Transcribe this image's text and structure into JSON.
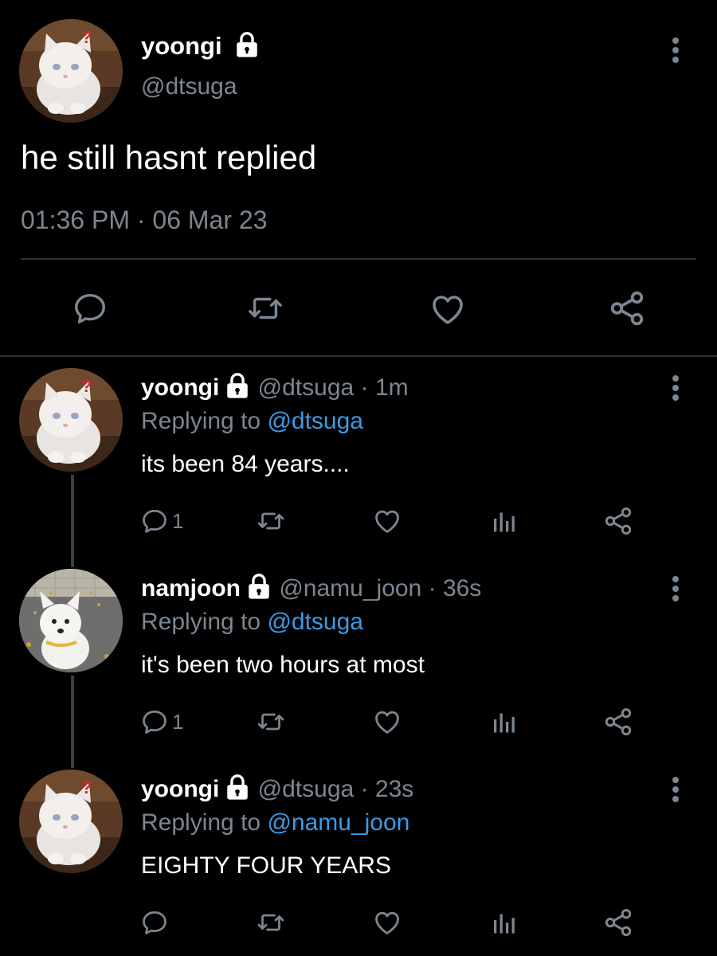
{
  "main_tweet": {
    "name": "yoongi",
    "handle": "@dtsuga",
    "text": "he still hasnt replied",
    "time": "01:36 PM",
    "separator": "·",
    "date": "06 Mar 23",
    "icons": [
      "reply-icon",
      "retweet-icon",
      "like-icon",
      "share-icon",
      "more-icon",
      "lock-icon"
    ]
  },
  "replies": [
    {
      "name": "yoongi",
      "handle": "@dtsuga",
      "time_sep": "·",
      "time": "1m",
      "replying_prefix": "Replying to",
      "replying_to": "@dtsuga",
      "text": "its been 84 years....",
      "reply_count": "1",
      "avatar": "kitten"
    },
    {
      "name": "namjoon",
      "handle": "@namu_joon",
      "time_sep": "·",
      "time": "36s",
      "replying_prefix": "Replying to",
      "replying_to": "@dtsuga",
      "text": "it's been two hours at most",
      "reply_count": "1",
      "avatar": "puppy"
    },
    {
      "name": "yoongi",
      "handle": "@dtsuga",
      "time_sep": "·",
      "time": "23s",
      "replying_prefix": "Replying to",
      "replying_to": "@namu_joon",
      "text": "EIGHTY FOUR YEARS",
      "reply_count": "",
      "avatar": "kitten"
    }
  ],
  "colors": {
    "background": "#000000",
    "text_primary": "#e7e9ea",
    "text_secondary": "#7b8690",
    "link": "#3a9be6",
    "divider": "#2f3336",
    "question_mark": "#d1262c"
  }
}
